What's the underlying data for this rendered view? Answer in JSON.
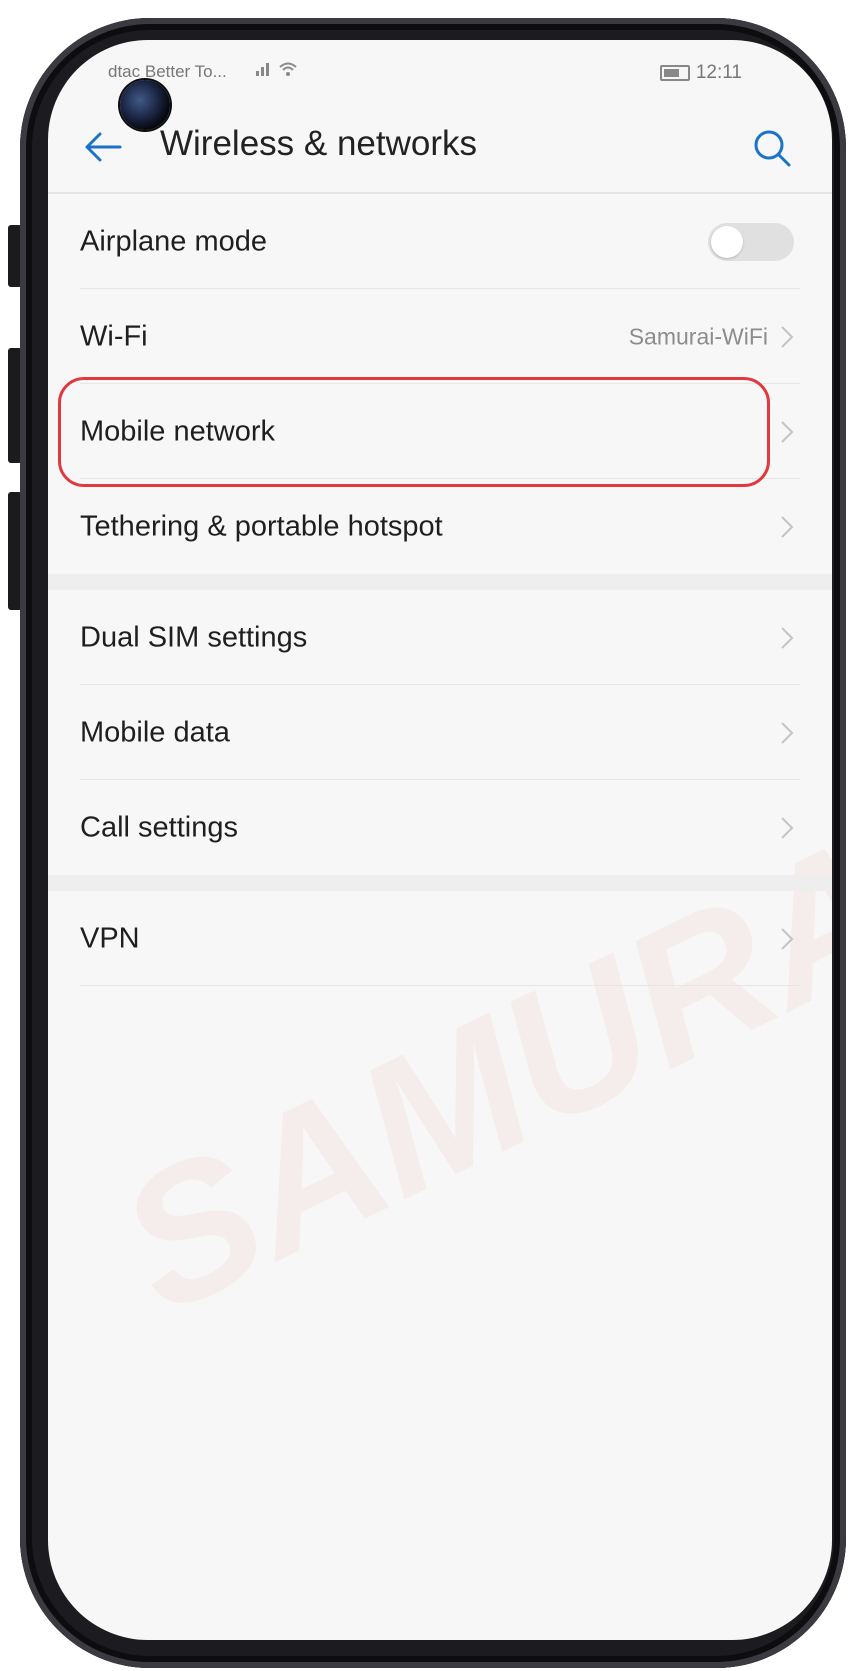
{
  "status_bar": {
    "carrier": "dtac Better To...",
    "battery_level": "71",
    "time": "12:11"
  },
  "header": {
    "title": "Wireless & networks",
    "back_icon": "back-arrow-icon",
    "search_icon": "search-icon"
  },
  "list": {
    "airplane_mode": {
      "label": "Airplane mode",
      "enabled": false
    },
    "wifi": {
      "label": "Wi-Fi",
      "value": "Samurai-WiFi"
    },
    "mobile_network": {
      "label": "Mobile network",
      "highlighted": true
    },
    "tethering": {
      "label": "Tethering & portable hotspot"
    },
    "dual_sim": {
      "label": "Dual SIM settings"
    },
    "mobile_data": {
      "label": "Mobile data"
    },
    "call_settings": {
      "label": "Call settings"
    },
    "vpn": {
      "label": "VPN"
    }
  },
  "watermark": "SAMURAI SIM",
  "colors": {
    "accent": "#1a73c8",
    "highlight": "#e0393e",
    "background": "#f7f7f7"
  }
}
